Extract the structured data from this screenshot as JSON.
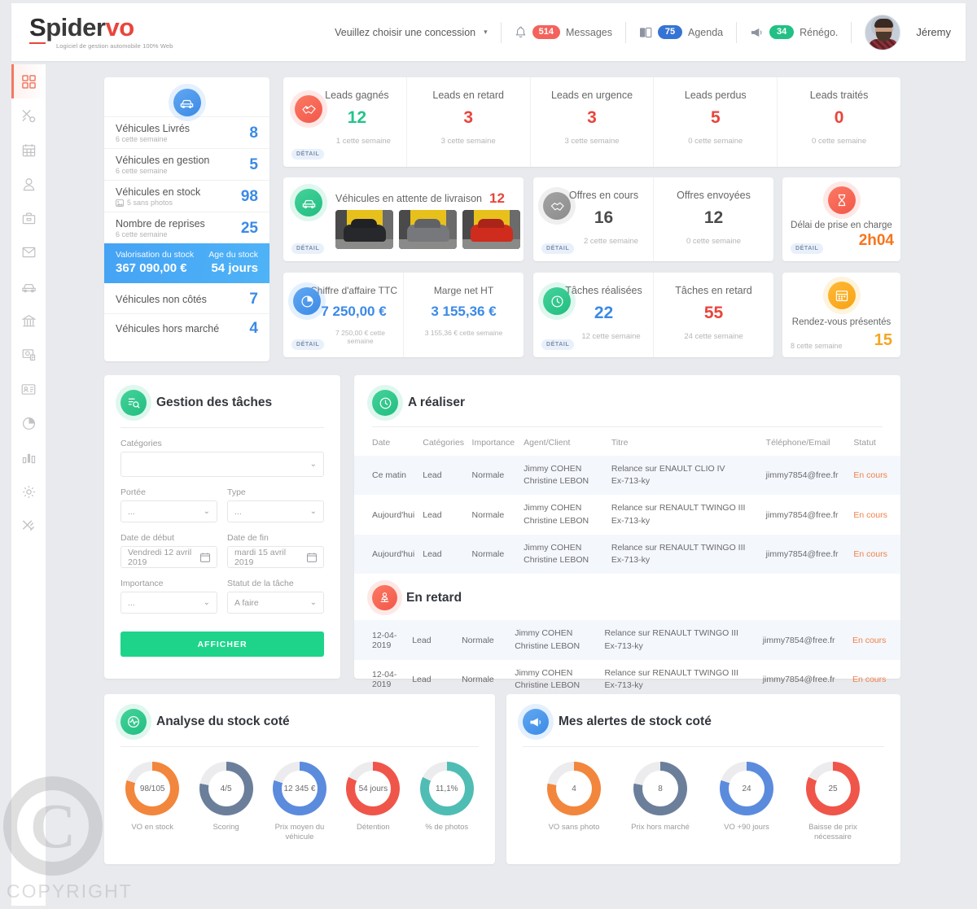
{
  "header": {
    "logo_main": "S",
    "logo_rest": "pider",
    "logo_vo": "vo",
    "logo_tagline": "Logiciel de gestion automobile 100% Web",
    "concession": "Veuillez choisir une concession",
    "caret": "▾",
    "messages": {
      "count": "514",
      "label": "Messages",
      "color": "#f4625c"
    },
    "agenda": {
      "count": "75",
      "label": "Agenda",
      "color": "#3574d4"
    },
    "renego": {
      "count": "34",
      "label": "Rénégo.",
      "color": "#23c086"
    },
    "user_name": "Jéremy"
  },
  "sidebar": {
    "items": [
      {
        "icon": "dashboard-grid-icon",
        "active": true
      },
      {
        "icon": "tools-icon",
        "active": false
      },
      {
        "icon": "calendar-icon",
        "active": false
      },
      {
        "icon": "person-icon",
        "active": false
      },
      {
        "icon": "briefcase-icon",
        "active": false
      },
      {
        "icon": "envelope-icon",
        "active": false
      },
      {
        "icon": "car-icon",
        "active": false
      },
      {
        "icon": "bank-icon",
        "active": false
      },
      {
        "icon": "photo-search-icon",
        "active": false
      },
      {
        "icon": "id-card-icon",
        "active": false
      },
      {
        "icon": "pie-chart-icon",
        "active": false
      },
      {
        "icon": "bar-chart-icon",
        "active": false
      },
      {
        "icon": "gear-icon",
        "active": false
      },
      {
        "icon": "tools-alt-icon",
        "active": false
      }
    ]
  },
  "vehicles_panel": {
    "icon": "car-icon",
    "rows": [
      {
        "label": "Véhicules Livrés",
        "sub": "6 cette semaine",
        "value": "8",
        "sub_icon": ""
      },
      {
        "label": "Véhicules en gestion",
        "sub": "6 cette semaine",
        "value": "5",
        "sub_icon": ""
      },
      {
        "label": "Véhicules en stock",
        "sub": "5 sans photos",
        "value": "98",
        "sub_icon": "image-icon"
      },
      {
        "label": "Nombre de reprises",
        "sub": "6 cette semaine",
        "value": "25",
        "sub_icon": ""
      }
    ],
    "highlight": {
      "left_label": "Valorisation du stock",
      "left_value": "367 090,00 €",
      "right_label": "Age du stock",
      "right_value": "54 jours"
    },
    "rows_bottom": [
      {
        "label": "Véhicules non côtés",
        "value": "7"
      },
      {
        "label": "Véhicules hors marché",
        "value": "4"
      }
    ]
  },
  "leads_card": {
    "icon": "handshake-key-icon",
    "detail_label": "DÉTAIL",
    "cells": [
      {
        "title": "Leads gagnés",
        "value": "12",
        "value_color": "green",
        "sub": "1 cette semaine"
      },
      {
        "title": "Leads en retard",
        "value": "3",
        "value_color": "red",
        "sub": "3 cette semaine"
      },
      {
        "title": "Leads en urgence",
        "value": "3",
        "value_color": "red",
        "sub": "3 cette semaine"
      },
      {
        "title": "Leads perdus",
        "value": "5",
        "value_color": "red",
        "sub": "0 cette semaine"
      },
      {
        "title": "Leads traités",
        "value": "0",
        "value_color": "red",
        "sub": "0 cette semaine"
      }
    ]
  },
  "livraison_card": {
    "icon": "car-icon",
    "title": "Véhicules en attente de livraison",
    "value": "12",
    "detail_label": "DÉTAIL",
    "thumbnails": [
      {
        "name": "vehicle-thumb-black",
        "color": "#27282c"
      },
      {
        "name": "vehicle-thumb-gray",
        "color": "#76787c"
      },
      {
        "name": "vehicle-thumb-red",
        "color": "#cf2c1e"
      }
    ]
  },
  "offres_card": {
    "icon": "handshake-icon",
    "detail_label": "DÉTAIL",
    "cells": [
      {
        "title": "Offres en cours",
        "value": "16",
        "sub": "2 cette semaine"
      },
      {
        "title": "Offres envoyées",
        "value": "12",
        "sub": "0 cette semaine"
      }
    ]
  },
  "delai_card": {
    "icon": "hourglass-icon",
    "title": "Délai de prise en charge",
    "detail_label": "DÉTAIL",
    "value": "2h04"
  },
  "ca_card": {
    "icon": "pie-clock-icon",
    "detail_label": "DÉTAIL",
    "cells": [
      {
        "title": "Chiffre d'affaire TTC",
        "value": "7 250,00 €",
        "sub": "7 250,00 € cette semaine"
      },
      {
        "title": "Marge net HT",
        "value": "3 155,36 €",
        "sub": "3 155,36 € cette semaine"
      }
    ]
  },
  "taches_card": {
    "icon": "clock-icon",
    "detail_label": "DÉTAIL",
    "cells": [
      {
        "title": "Tâches réalisées",
        "value": "22",
        "value_color": "blue",
        "sub": "12 cette semaine"
      },
      {
        "title": "Tâches en retard",
        "value": "55",
        "value_color": "red",
        "sub": "24 cette semaine"
      }
    ]
  },
  "rdv_card": {
    "icon": "calendar-icon",
    "title": "Rendez-vous présentés",
    "sub": "8 cette semaine",
    "value": "15"
  },
  "task_form": {
    "icon": "task-search-icon",
    "title": "Gestion des tâches",
    "fields": {
      "categories_label": "Catégories",
      "categories_value": "",
      "portee_label": "Portée",
      "portee_value": "...",
      "type_label": "Type",
      "type_value": "...",
      "date_debut_label": "Date de début",
      "date_debut_value": "Vendredi 12 avril 2019",
      "date_fin_label": "Date de fin",
      "date_fin_value": "mardi 15 avril 2019",
      "importance_label": "Importance",
      "importance_value": "...",
      "statut_label": "Statut de la tâche",
      "statut_value": "A faire"
    },
    "submit_label": "AFFICHER"
  },
  "tasks_panel": {
    "a_realiser": {
      "icon": "clock-icon",
      "title": "A réaliser",
      "columns": [
        "Date",
        "Catégories",
        "Importance",
        "Agent/Client",
        "Titre",
        "Téléphone/Email",
        "Statut"
      ],
      "rows": [
        {
          "date": "Ce matin",
          "categorie": "Lead",
          "importance": "Normale",
          "agent": "Jimmy COHEN",
          "client": "Christine LEBON",
          "titre": "Relance sur ENAULT CLIO IV",
          "titre2": "Ex-713-ky",
          "email": "jimmy7854@free.fr",
          "statut": "En cours"
        },
        {
          "date": "Aujourd'hui",
          "categorie": "Lead",
          "importance": "Normale",
          "agent": "Jimmy COHEN",
          "client": "Christine LEBON",
          "titre": "Relance sur RENAULT TWINGO III",
          "titre2": "Ex-713-ky",
          "email": "jimmy7854@free.fr",
          "statut": "En cours"
        },
        {
          "date": "Aujourd'hui",
          "categorie": "Lead",
          "importance": "Normale",
          "agent": "Jimmy COHEN",
          "client": "Christine LEBON",
          "titre": "Relance sur RENAULT TWINGO III",
          "titre2": "Ex-713-ky",
          "email": "jimmy7854@free.fr",
          "statut": "En cours"
        }
      ]
    },
    "en_retard": {
      "icon": "alert-person-icon",
      "title": "En retard",
      "rows": [
        {
          "date": "12-04-2019",
          "categorie": "Lead",
          "importance": "Normale",
          "agent": "Jimmy COHEN",
          "client": "Christine LEBON",
          "titre": "Relance sur RENAULT TWINGO III",
          "titre2": "Ex-713-ky",
          "email": "jimmy7854@free.fr",
          "statut": "En cours"
        },
        {
          "date": "12-04-2019",
          "categorie": "Lead",
          "importance": "Normale",
          "agent": "Jimmy COHEN",
          "client": "Christine LEBON",
          "titre": "Relance sur RENAULT TWINGO III",
          "titre2": "Ex-713-ky",
          "email": "jimmy7854@free.fr",
          "statut": "En cours"
        }
      ]
    }
  },
  "chart_data": [
    {
      "type": "pie",
      "title": "Analyse du stock coté",
      "icon": "pulse-icon",
      "legend_position": "below-each",
      "slices": [
        {
          "label": "VO en stock",
          "display": "98/105",
          "percent": 80,
          "color": "#f2863c",
          "track": "#ececee"
        },
        {
          "label": "Scoring",
          "display": "4/5",
          "percent": 78,
          "color": "#6b7f9b",
          "track": "#ececee"
        },
        {
          "label": "Prix moyen du véhicule",
          "display": "12 345 €",
          "percent": 80,
          "color": "#5b8bdd",
          "track": "#ececee"
        },
        {
          "label": "Détention",
          "display": "54 jours",
          "percent": 82,
          "color": "#f0554a",
          "track": "#ececee"
        },
        {
          "label": "% de photos",
          "display": "11,1%",
          "percent": 82,
          "color": "#4fbdb4",
          "track": "#ececee"
        }
      ]
    },
    {
      "type": "pie",
      "title": "Mes alertes de stock coté",
      "icon": "megaphone-icon",
      "legend_position": "below-each",
      "slices": [
        {
          "label": "VO sans photo",
          "display": "4",
          "percent": 78,
          "color": "#f2863c",
          "track": "#ececee"
        },
        {
          "label": "Prix hors marché",
          "display": "8",
          "percent": 78,
          "color": "#6b7f9b",
          "track": "#ececee"
        },
        {
          "label": "VO +90 jours",
          "display": "24",
          "percent": 80,
          "color": "#5b8bdd",
          "track": "#ececee"
        },
        {
          "label": "Baisse de prix nécessaire",
          "display": "25",
          "percent": 82,
          "color": "#f0554a",
          "track": "#ececee"
        }
      ]
    }
  ],
  "watermark": {
    "symbol": "C",
    "text": "COPYRIGHT"
  }
}
